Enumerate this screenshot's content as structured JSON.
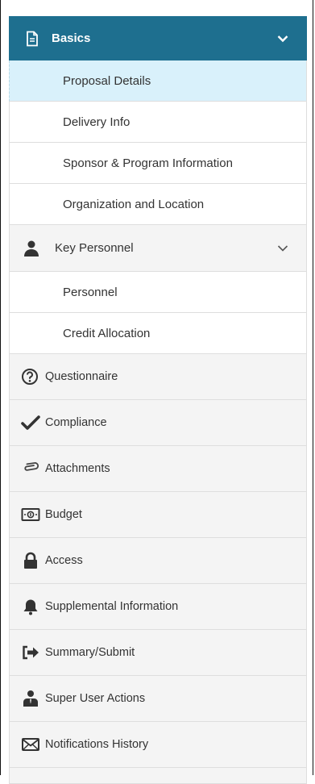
{
  "nav": {
    "basics": {
      "label": "Basics",
      "items": [
        {
          "label": "Proposal Details"
        },
        {
          "label": "Delivery Info"
        },
        {
          "label": "Sponsor & Program Information"
        },
        {
          "label": "Organization and Location"
        }
      ]
    },
    "key_personnel": {
      "label": "Key Personnel",
      "items": [
        {
          "label": "Personnel"
        },
        {
          "label": "Credit Allocation"
        }
      ]
    },
    "sections": [
      {
        "label": "Questionnaire",
        "icon": "question-circle-icon"
      },
      {
        "label": "Compliance",
        "icon": "checkmark-icon"
      },
      {
        "label": "Attachments",
        "icon": "paperclip-icon"
      },
      {
        "label": "Budget",
        "icon": "money-bill-icon"
      },
      {
        "label": "Access",
        "icon": "lock-icon"
      },
      {
        "label": "Supplemental Information",
        "icon": "bell-icon"
      },
      {
        "label": "Summary/Submit",
        "icon": "sign-out-arrow-icon"
      },
      {
        "label": "Super User Actions",
        "icon": "user-tie-icon"
      },
      {
        "label": "Notifications History",
        "icon": "envelope-icon"
      }
    ]
  },
  "colors": {
    "active_header": "#1e6f8f",
    "selected_item": "#d9f1fb",
    "section_bg": "#f4f4f4"
  }
}
